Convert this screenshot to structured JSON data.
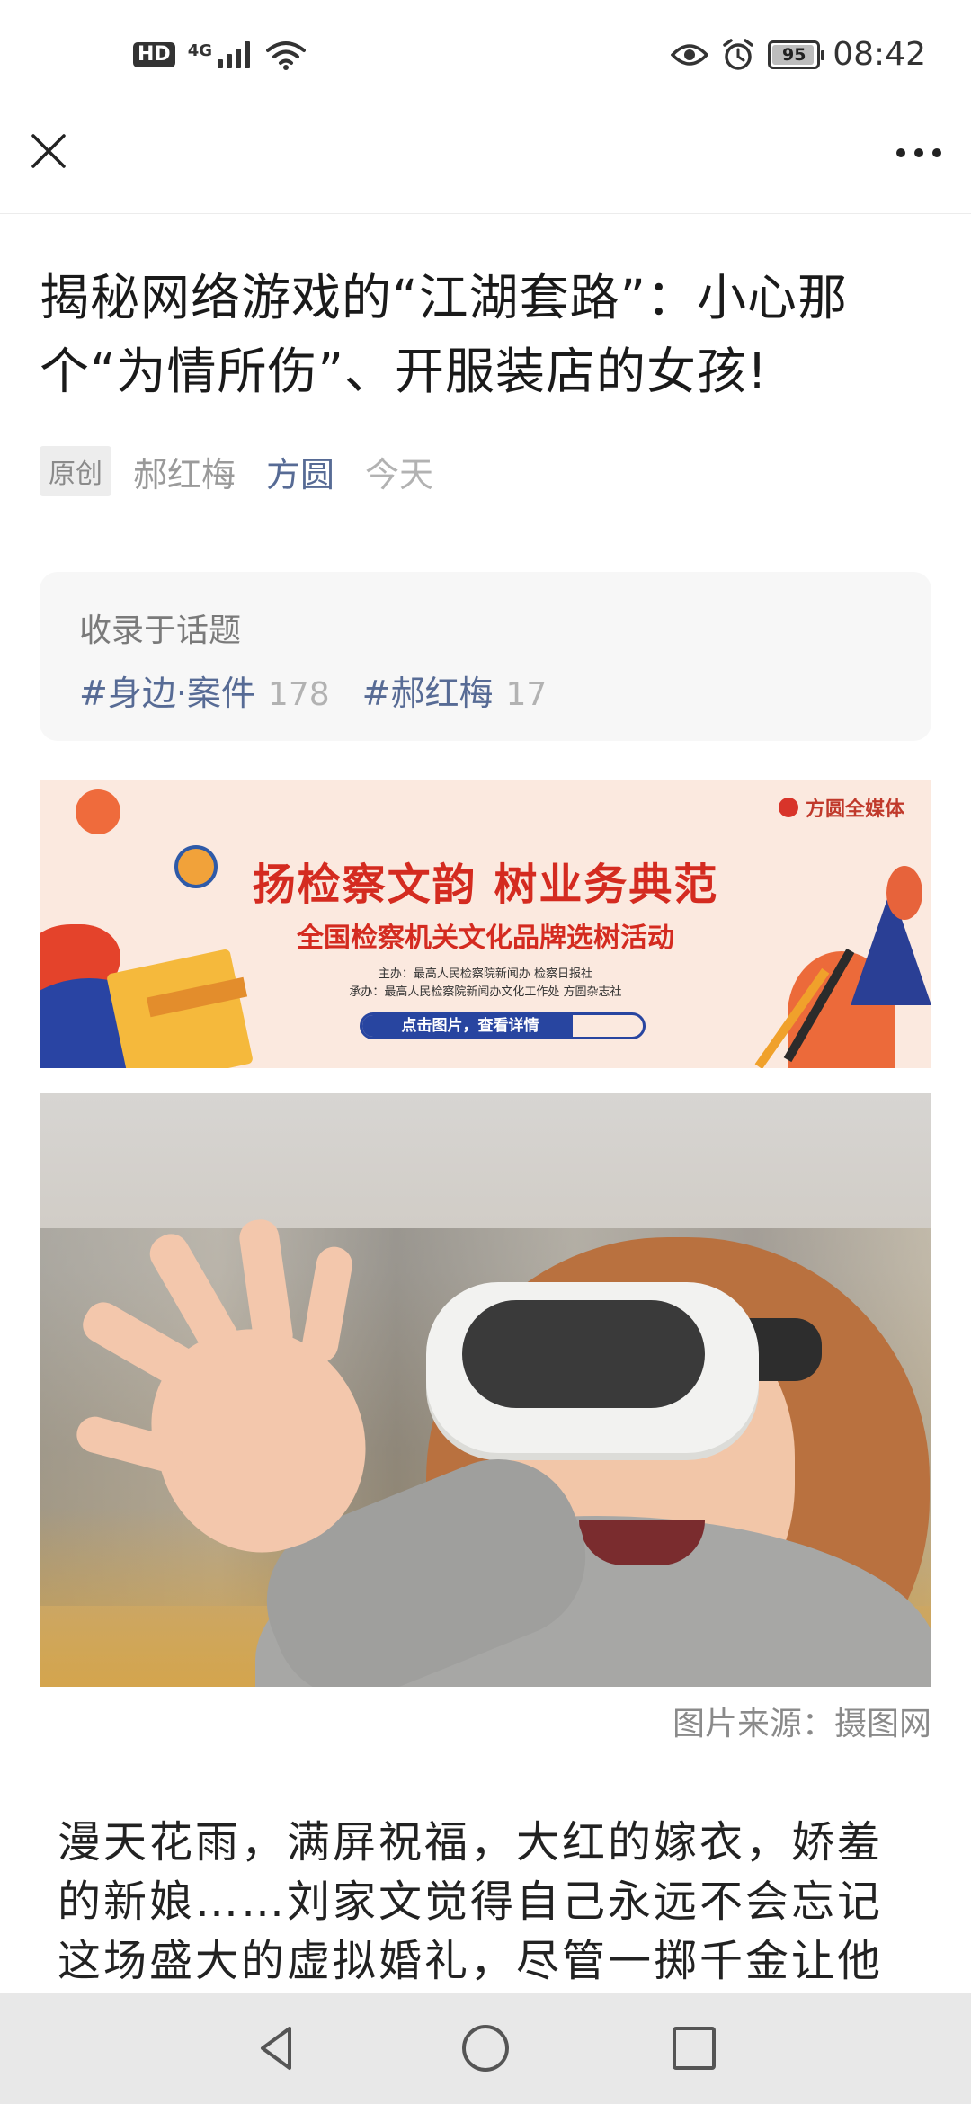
{
  "status_bar": {
    "hd_label": "HD",
    "network_label": "4G",
    "battery_level": "95",
    "time": "08:42"
  },
  "article": {
    "title": "揭秘网络游戏的“江湖套路”：小心那个“为情所伤”、开服装店的女孩!",
    "original_tag": "原创",
    "author": "郝红梅",
    "account": "方圆",
    "date": "今天",
    "topics": {
      "label": "收录于话题",
      "items": [
        {
          "name": "#身边·案件",
          "count": "178"
        },
        {
          "name": "#郝红梅",
          "count": "17"
        }
      ]
    },
    "banner": {
      "logo_text": "方圆全媒体",
      "headline": "扬检察文韵  树业务典范",
      "subline": "全国检察机关文化品牌选树活动",
      "organizer": "主办：最高人民检察院新闻办 检察日报社",
      "co_organizer": "承办：最高人民检察院新闻办文化工作处 方圆杂志社",
      "cta": "点击图片，查看详情"
    },
    "photo_caption": "图片来源：摄图网",
    "body_paragraph": "漫天花雨，满屏祝福，大红的嫁衣，娇羞的新娘……刘家文觉得自己永远不会忘记这场盛大的虚拟婚礼，尽管一掷千金让他"
  },
  "icons": {
    "close": "close-icon",
    "more": "more-icon",
    "back": "back-icon",
    "home": "home-icon",
    "recents": "recents-icon"
  },
  "colors": {
    "link": "#576b95",
    "muted": "#b2b2b2",
    "banner_red": "#d42b20",
    "banner_blue": "#2845a0"
  }
}
